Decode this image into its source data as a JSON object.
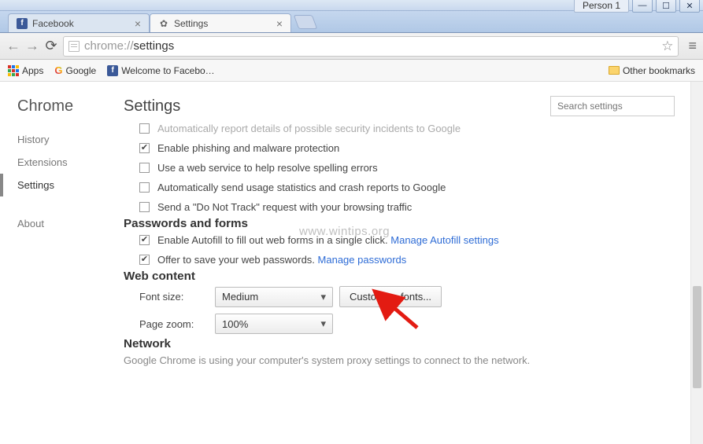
{
  "window": {
    "person": "Person 1"
  },
  "tabs": [
    {
      "label": "Facebook",
      "icon": "facebook"
    },
    {
      "label": "Settings",
      "icon": "gear"
    }
  ],
  "omnibox": {
    "scheme": "chrome://",
    "path": "settings"
  },
  "bookmarks": {
    "apps": "Apps",
    "google": "Google",
    "fb": "Welcome to Facebo…",
    "other": "Other bookmarks"
  },
  "sidebar": {
    "title": "Chrome",
    "items": [
      "History",
      "Extensions",
      "Settings"
    ],
    "footer": "About"
  },
  "main": {
    "title": "Settings",
    "search_placeholder": "Search settings",
    "privacy_rows": {
      "r0": "Automatically report details of possible security incidents to Google",
      "r1": "Enable phishing and malware protection",
      "r2": "Use a web service to help resolve spelling errors",
      "r3": "Automatically send usage statistics and crash reports to Google",
      "r4": "Send a \"Do Not Track\" request with your browsing traffic"
    },
    "passwords": {
      "heading": "Passwords and forms",
      "autofill_text": "Enable Autofill to fill out web forms in a single click. ",
      "autofill_link": "Manage Autofill settings",
      "save_text": "Offer to save your web passwords. ",
      "save_link": "Manage passwords"
    },
    "webcontent": {
      "heading": "Web content",
      "font_label": "Font size:",
      "font_value": "Medium",
      "customize": "Customize fonts...",
      "zoom_label": "Page zoom:",
      "zoom_value": "100%"
    },
    "network": {
      "heading": "Network",
      "text": "Google Chrome is using your computer's system proxy settings to connect to the network."
    }
  },
  "watermark": "www.wintips.org"
}
